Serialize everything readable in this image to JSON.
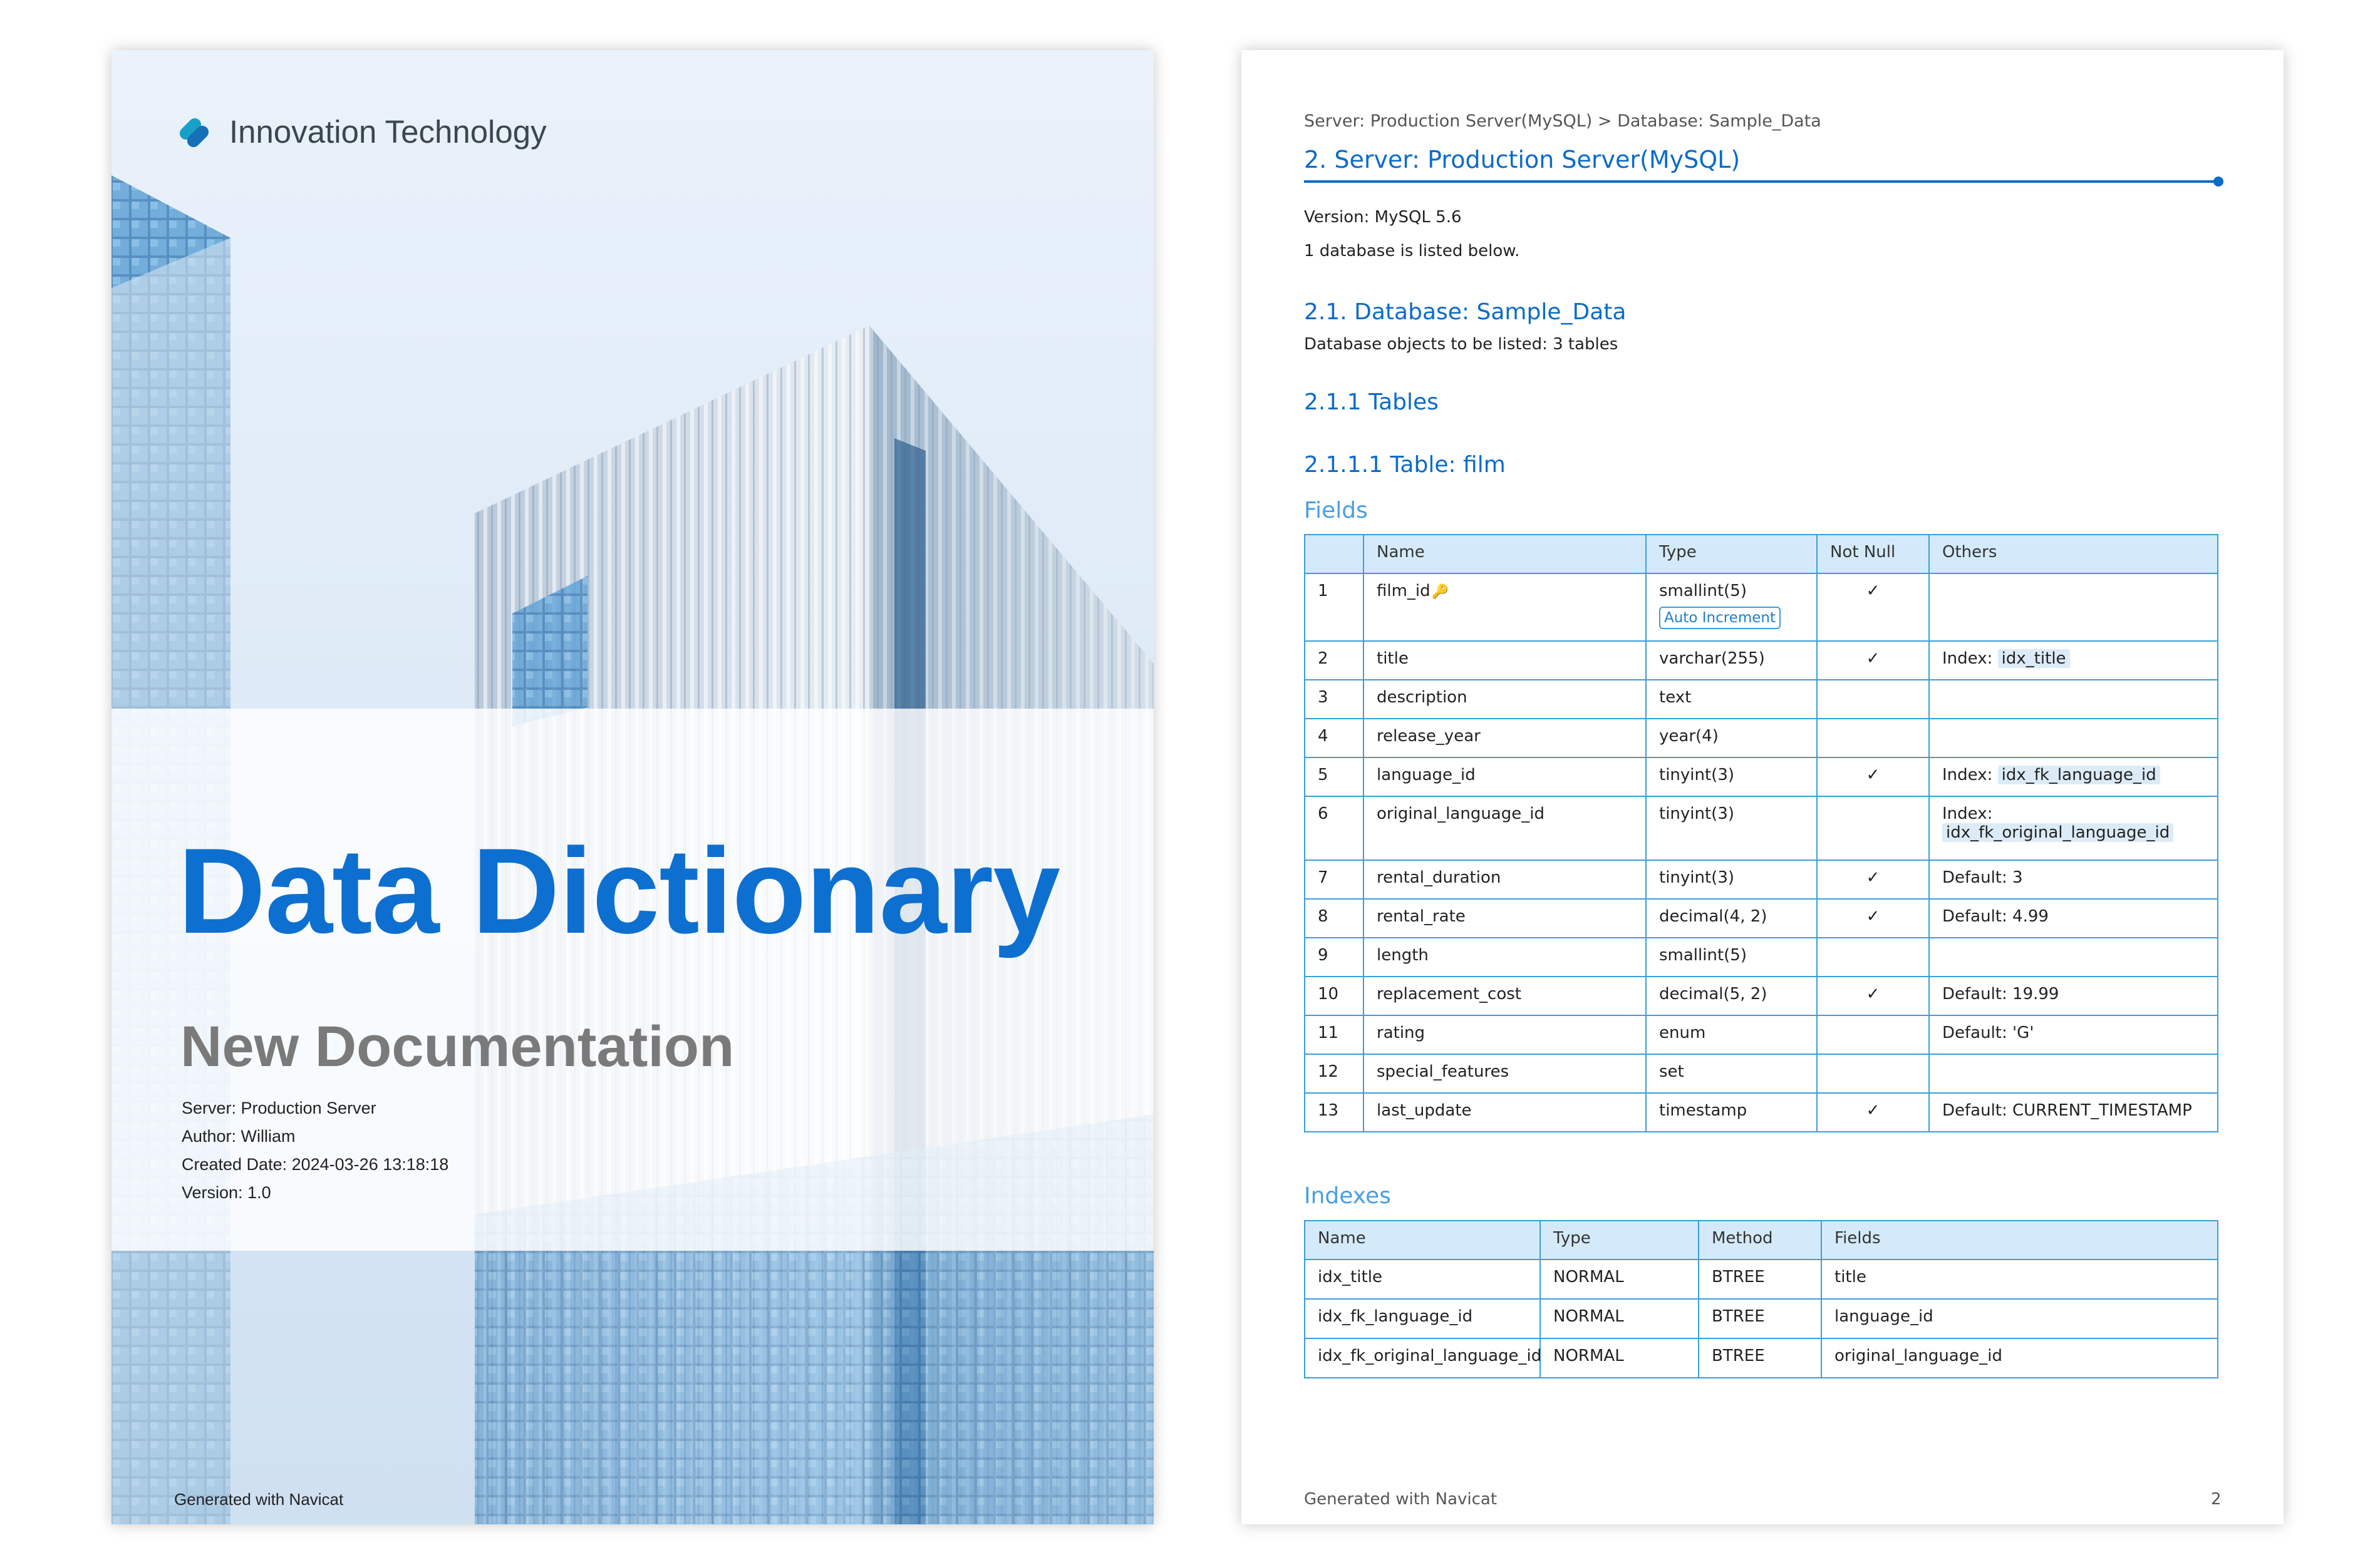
{
  "cover": {
    "logo_text": "Innovation Technology",
    "title": "Data Dictionary",
    "subtitle": "New Documentation",
    "meta": [
      "Server: Production Server",
      "Author: William",
      "Created Date: 2024-03-26 13:18:18",
      "Version: 1.0"
    ],
    "footer": "Generated with Navicat"
  },
  "page": {
    "breadcrumb": "Server: Production Server(MySQL) > Database: Sample_Data",
    "server_heading": "2.  Server: Production Server(MySQL)",
    "version": "Version: MySQL 5.6",
    "db_count": "1 database is listed below.",
    "db_heading": "2.1. Database: Sample_Data",
    "db_objects": "Database objects to be listed: 3 tables",
    "tables_heading": "2.1.1 Tables",
    "table_heading": "2.1.1.1 Table: film",
    "fields_heading": "Fields",
    "fields_columns": [
      "",
      "Name",
      "Type",
      "Not Null",
      "Others"
    ],
    "fields": [
      {
        "no": "1",
        "name": "film_id",
        "type": "smallint(5)",
        "badge": "Auto Increment",
        "notnull": "✓",
        "others_label": "",
        "others_value": ""
      },
      {
        "no": "2",
        "name": "title",
        "type": "varchar(255)",
        "badge": "",
        "notnull": "✓",
        "others_label": "Index:",
        "others_value": "idx_title"
      },
      {
        "no": "3",
        "name": "description",
        "type": "text",
        "badge": "",
        "notnull": "",
        "others_label": "",
        "others_value": ""
      },
      {
        "no": "4",
        "name": "release_year",
        "type": "year(4)",
        "badge": "",
        "notnull": "",
        "others_label": "",
        "others_value": ""
      },
      {
        "no": "5",
        "name": "language_id",
        "type": "tinyint(3)",
        "badge": "",
        "notnull": "✓",
        "others_label": "Index:",
        "others_value": "idx_fk_language_id"
      },
      {
        "no": "6",
        "name": "original_language_id",
        "type": "tinyint(3)",
        "badge": "",
        "notnull": "",
        "others_label": "Index:",
        "others_value": "idx_fk_original_language_id"
      },
      {
        "no": "7",
        "name": "rental_duration",
        "type": "tinyint(3)",
        "badge": "",
        "notnull": "✓",
        "others_label": "Default: 3",
        "others_value": ""
      },
      {
        "no": "8",
        "name": "rental_rate",
        "type": "decimal(4, 2)",
        "badge": "",
        "notnull": "✓",
        "others_label": "Default: 4.99",
        "others_value": ""
      },
      {
        "no": "9",
        "name": "length",
        "type": "smallint(5)",
        "badge": "",
        "notnull": "",
        "others_label": "",
        "others_value": ""
      },
      {
        "no": "10",
        "name": "replacement_cost",
        "type": "decimal(5, 2)",
        "badge": "",
        "notnull": "✓",
        "others_label": "Default: 19.99",
        "others_value": ""
      },
      {
        "no": "11",
        "name": "rating",
        "type": "enum",
        "badge": "",
        "notnull": "",
        "others_label": "Default: 'G'",
        "others_value": ""
      },
      {
        "no": "12",
        "name": "special_features",
        "type": "set",
        "badge": "",
        "notnull": "",
        "others_label": "",
        "others_value": ""
      },
      {
        "no": "13",
        "name": "last_update",
        "type": "timestamp",
        "badge": "",
        "notnull": "✓",
        "others_label": "Default: CURRENT_TIMESTAMP",
        "others_value": ""
      }
    ],
    "indexes_heading": "Indexes",
    "indexes_columns": [
      "Name",
      "Type",
      "Method",
      "Fields"
    ],
    "indexes": [
      [
        "idx_title",
        "NORMAL",
        "BTREE",
        "title"
      ],
      [
        "idx_fk_language_id",
        "NORMAL",
        "BTREE",
        "language_id"
      ],
      [
        "idx_fk_original_language_id",
        "NORMAL",
        "BTREE",
        "original_language_id"
      ]
    ],
    "footer": "Generated with Navicat",
    "page_number": "2"
  },
  "icons": {
    "logo": "innovation-logo-icon",
    "primary_key": "key-icon"
  },
  "colors": {
    "accent": "#0a6cc8",
    "table_border": "#3a9ed8",
    "header_fill": "#d4eafa",
    "cover_title": "#0d6fd0",
    "cover_subtitle": "#7a7a7a"
  }
}
